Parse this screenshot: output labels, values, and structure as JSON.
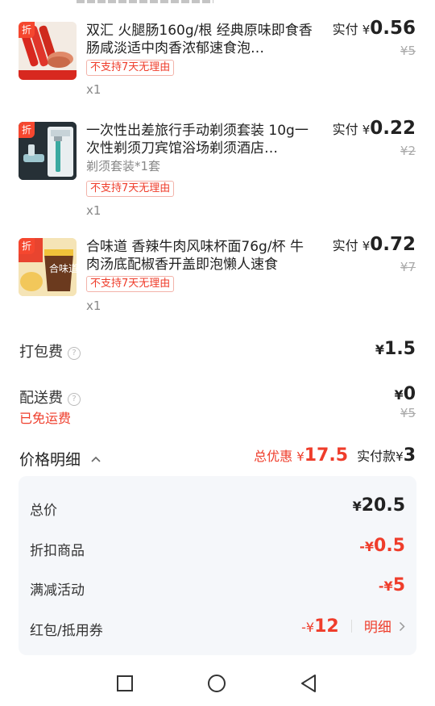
{
  "items": [
    {
      "badge": "折",
      "title": "双汇 火腿肠160g/根 经典原味即食香肠咸淡适中肉香浓郁速食泡…",
      "spec": "",
      "tag": "不支持7天无理由",
      "qty": "x1",
      "paid_label": "实付",
      "currency": "¥",
      "paid": "0.56",
      "original": "¥5"
    },
    {
      "badge": "折",
      "title": "一次性出差旅行手动剃须套装 10g一次性剃须刀宾馆浴场剃须酒店…",
      "spec": "剃须套装*1套",
      "tag": "不支持7天无理由",
      "qty": "x1",
      "paid_label": "实付",
      "currency": "¥",
      "paid": "0.22",
      "original": "¥2"
    },
    {
      "badge": "折",
      "title": "合味道 香辣牛肉风味杯面76g/杯 牛肉汤底配椒香开盖即泡懒人速食",
      "spec": "",
      "tag": "不支持7天无理由",
      "qty": "x1",
      "paid_label": "实付",
      "currency": "¥",
      "paid": "0.72",
      "original": "¥7"
    }
  ],
  "fees": {
    "packing_label": "打包费",
    "packing_value": "1.5",
    "delivery_label": "配送费",
    "delivery_value": "0",
    "delivery_original": "¥5",
    "free_delivery_note": "已免运费",
    "help_icon": "question-circle-icon"
  },
  "summary": {
    "title": "价格明细",
    "total_discount_label": "总优惠",
    "total_discount_value": "17.5",
    "paid_label": "实付款",
    "paid_value": "3",
    "currency": "¥"
  },
  "details": {
    "total_label": "总价",
    "total_value": "20.5",
    "discount_goods_label": "折扣商品",
    "discount_goods_value": "0.5",
    "full_reduction_label": "满减活动",
    "full_reduction_value": "5",
    "coupon_label": "红包/抵用券",
    "coupon_value": "12",
    "coupon_link": "明细",
    "minus_currency": "-¥"
  },
  "colors": {
    "accent": "#ef3d2b",
    "text": "#222222",
    "muted": "#888888",
    "panel": "#f5f7fa"
  }
}
